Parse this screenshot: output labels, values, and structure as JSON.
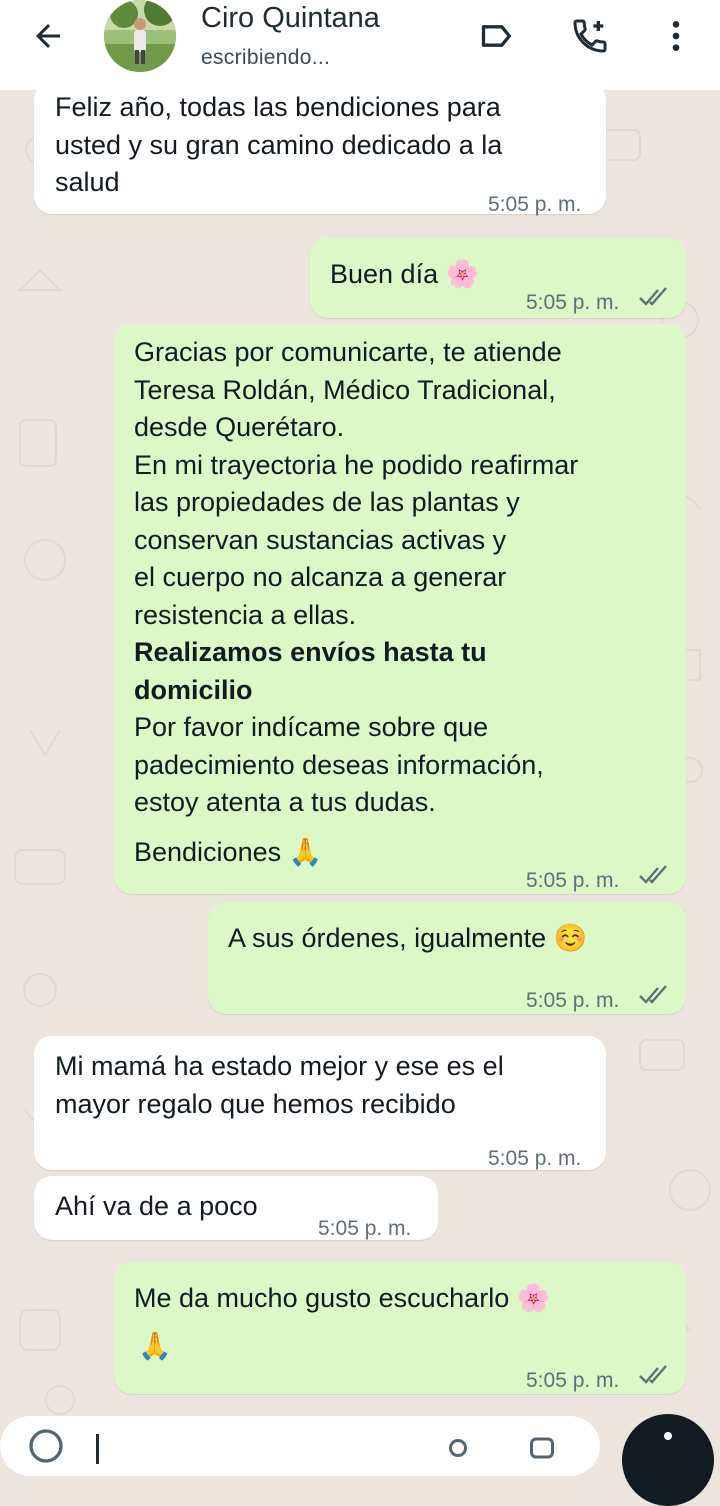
{
  "header": {
    "contact_name": "Ciro Quintana",
    "status": "escribiendo..."
  },
  "messages": [
    {
      "direction": "in",
      "text": "Feliz año, todas las bendiciones para\nusted y su gran camino dedicado a la\nsalud",
      "time": "5:05 p. m."
    },
    {
      "direction": "out",
      "text": "Buen día",
      "emoji": "🌸",
      "time": "5:05 p. m.",
      "read": true
    },
    {
      "direction": "out",
      "paragraph1": "Gracias por comunicarte, te atiende\nTeresa Roldán, Médico Tradicional,\ndesde Querétaro.\nEn mi trayectoria he podido reafirmar\nlas propiedades de las plantas y\nconservan  sustancias activas y\nel cuerpo no alcanza a generar\nresistencia a ellas.",
      "bold": "Realizamos envíos hasta tu\ndomicilio",
      "paragraph2": "Por favor indícame sobre que\npadecimiento deseas información,\nestoy atenta a tus dudas.",
      "closing": "Bendiciones",
      "emoji": "🙏",
      "time": "5:05 p. m.",
      "read": true
    },
    {
      "direction": "out",
      "text": "A sus órdenes, igualmente",
      "emoji": "☺️",
      "time": "5:05 p. m.",
      "read": true
    },
    {
      "direction": "in",
      "text": "Mi mamá ha estado mejor y ese es el\nmayor regalo que hemos recibido",
      "time": "5:05 p. m."
    },
    {
      "direction": "in",
      "text": "Ahí va de a poco",
      "time": "5:05 p. m."
    },
    {
      "direction": "out",
      "text": "Me da mucho gusto escucharlo",
      "emoji": "🌸",
      "emoji2": "🙏",
      "time": "5:05 p. m.",
      "read": true
    }
  ],
  "colors": {
    "incoming_bubble": "#ffffff",
    "outgoing_bubble": "#dcf8c6",
    "read_ticks": "#5f6f78",
    "background": "#ece5dd"
  },
  "icons": [
    "back-arrow-icon",
    "label-icon",
    "add-call-icon",
    "more-vert-icon",
    "double-check-icon",
    "emoji-icon",
    "attach-icon",
    "microphone-icon"
  ]
}
